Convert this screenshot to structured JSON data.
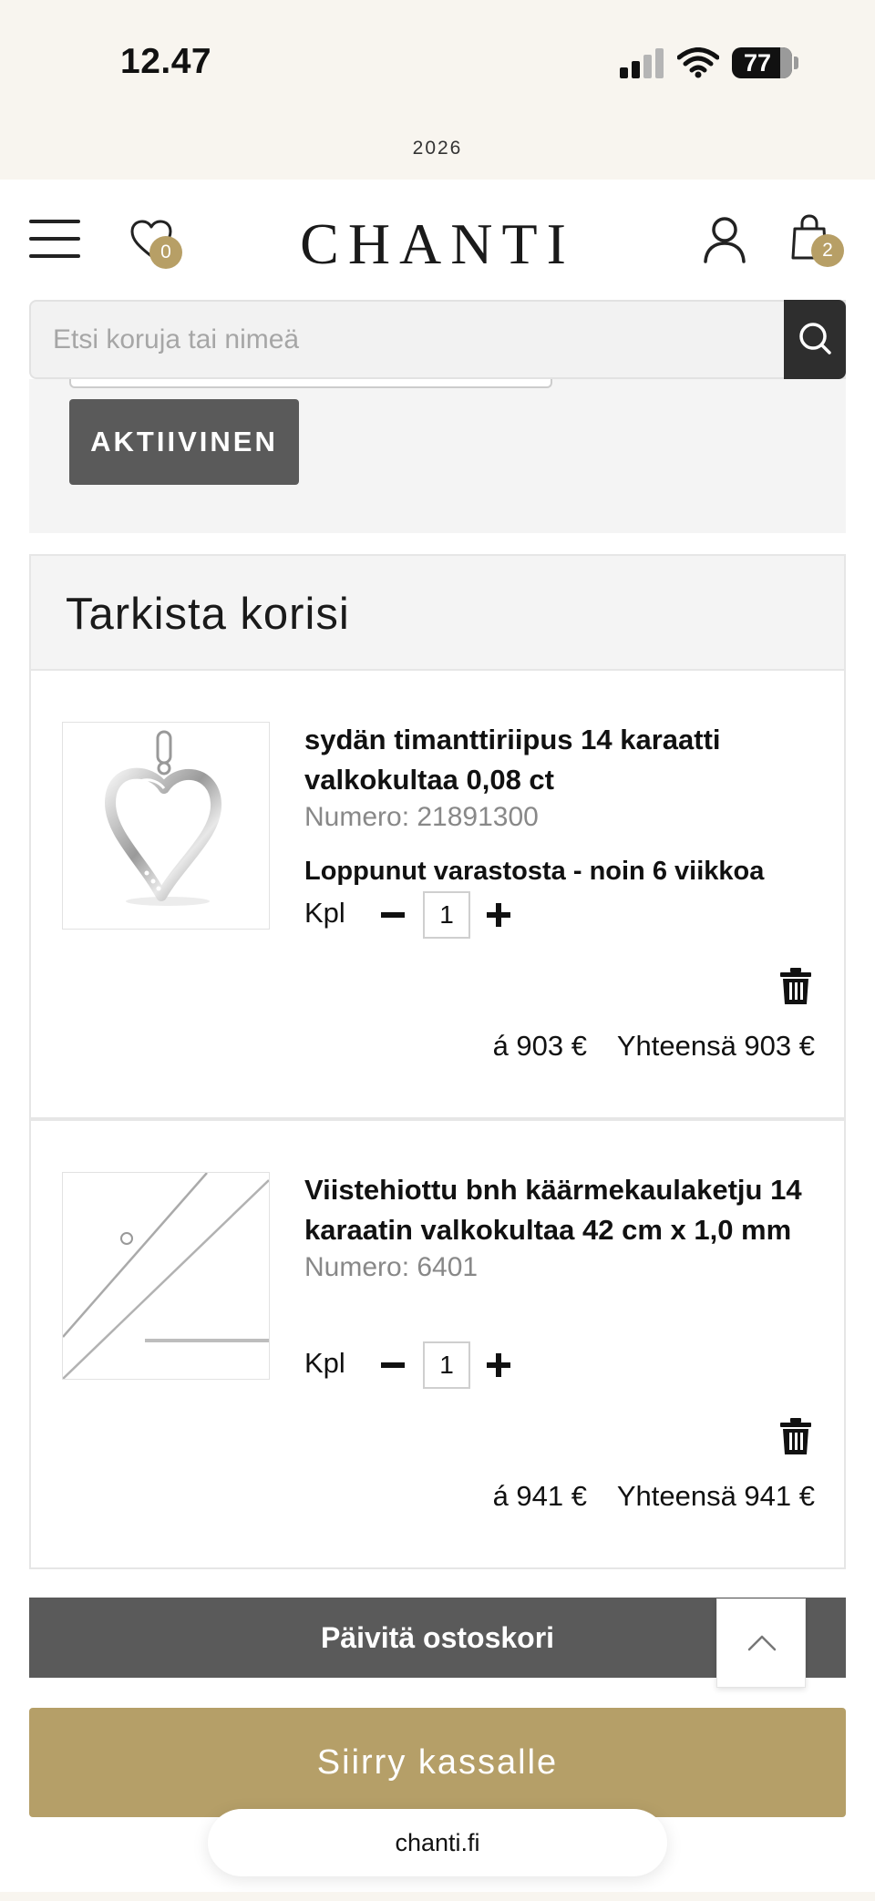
{
  "status_bar": {
    "time": "12.47",
    "battery": "77",
    "year": "2026"
  },
  "header": {
    "logo": "CHANTI",
    "wishlist_count": "0",
    "cart_count": "2",
    "icons": [
      "menu-icon",
      "heart-icon",
      "user-icon",
      "bag-icon"
    ]
  },
  "search": {
    "placeholder": "Etsi koruja tai nimeä",
    "icon": "search-icon"
  },
  "voucher": {
    "button_label": "AKTIIVINEN"
  },
  "cart": {
    "title": "Tarkista korisi",
    "qty_label": "Kpl",
    "items": [
      {
        "name": "sydän timanttiriipus 14 karaatti valkokultaa 0,08 ct",
        "number": "Numero: 21891300",
        "stock": "Loppunut varastosta - noin 6 viikkoa",
        "qty": "1",
        "unit_price": "á 903 €",
        "total": "Yhteensä 903 €",
        "image": "heart-pendant"
      },
      {
        "name": "Viistehiottu bnh käärmekaulaketju 14 karaatin valkokultaa 42 cm x 1,0 mm",
        "number": "Numero: 6401",
        "stock": "",
        "qty": "1",
        "unit_price": "á 941 €",
        "total": "Yhteensä 941 €",
        "image": "snake-chain"
      }
    ]
  },
  "buttons": {
    "update_cart": "Päivitä ostoskori",
    "checkout": "Siirry kassalle"
  },
  "browser": {
    "url": "chanti.fi"
  },
  "colors": {
    "accent_gold": "#b59f68",
    "dark_button": "#5a5a5a",
    "status_bg": "#f8f5ef"
  }
}
